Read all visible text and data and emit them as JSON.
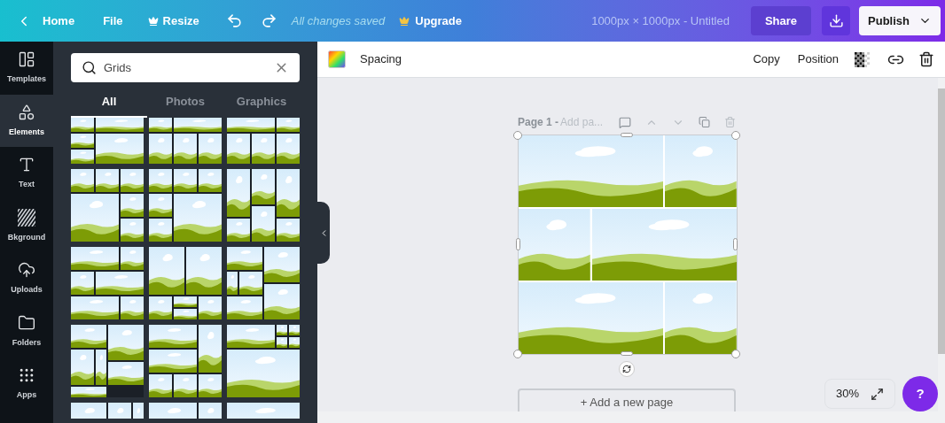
{
  "topbar": {
    "home": "Home",
    "file": "File",
    "resize": "Resize",
    "status": "All changes saved",
    "upgrade": "Upgrade",
    "doc_title": "1000px × 1000px - Untitled",
    "share": "Share",
    "publish": "Publish"
  },
  "sidebar": {
    "items": [
      {
        "label": "Templates",
        "kind": "templates",
        "selected": false
      },
      {
        "label": "Elements",
        "kind": "elements",
        "selected": true
      },
      {
        "label": "Text",
        "kind": "text",
        "selected": false
      },
      {
        "label": "Bkground",
        "kind": "background",
        "selected": false
      },
      {
        "label": "Uploads",
        "kind": "uploads",
        "selected": false
      },
      {
        "label": "Folders",
        "kind": "folders",
        "selected": false
      },
      {
        "label": "Apps",
        "kind": "apps",
        "selected": false
      }
    ]
  },
  "panel": {
    "search": {
      "value": "Grids"
    },
    "tabs": [
      {
        "label": "All",
        "selected": true
      },
      {
        "label": "Photos",
        "selected": false
      },
      {
        "label": "Graphics",
        "selected": false
      }
    ]
  },
  "toolbar": {
    "left": "Spacing",
    "copy": "Copy",
    "position": "Position"
  },
  "page": {
    "label": "Page 1 - ",
    "title_placeholder": "Add pa...",
    "add_page": "+ Add a new page"
  },
  "zoom": {
    "value": "30%"
  },
  "help": "?"
}
